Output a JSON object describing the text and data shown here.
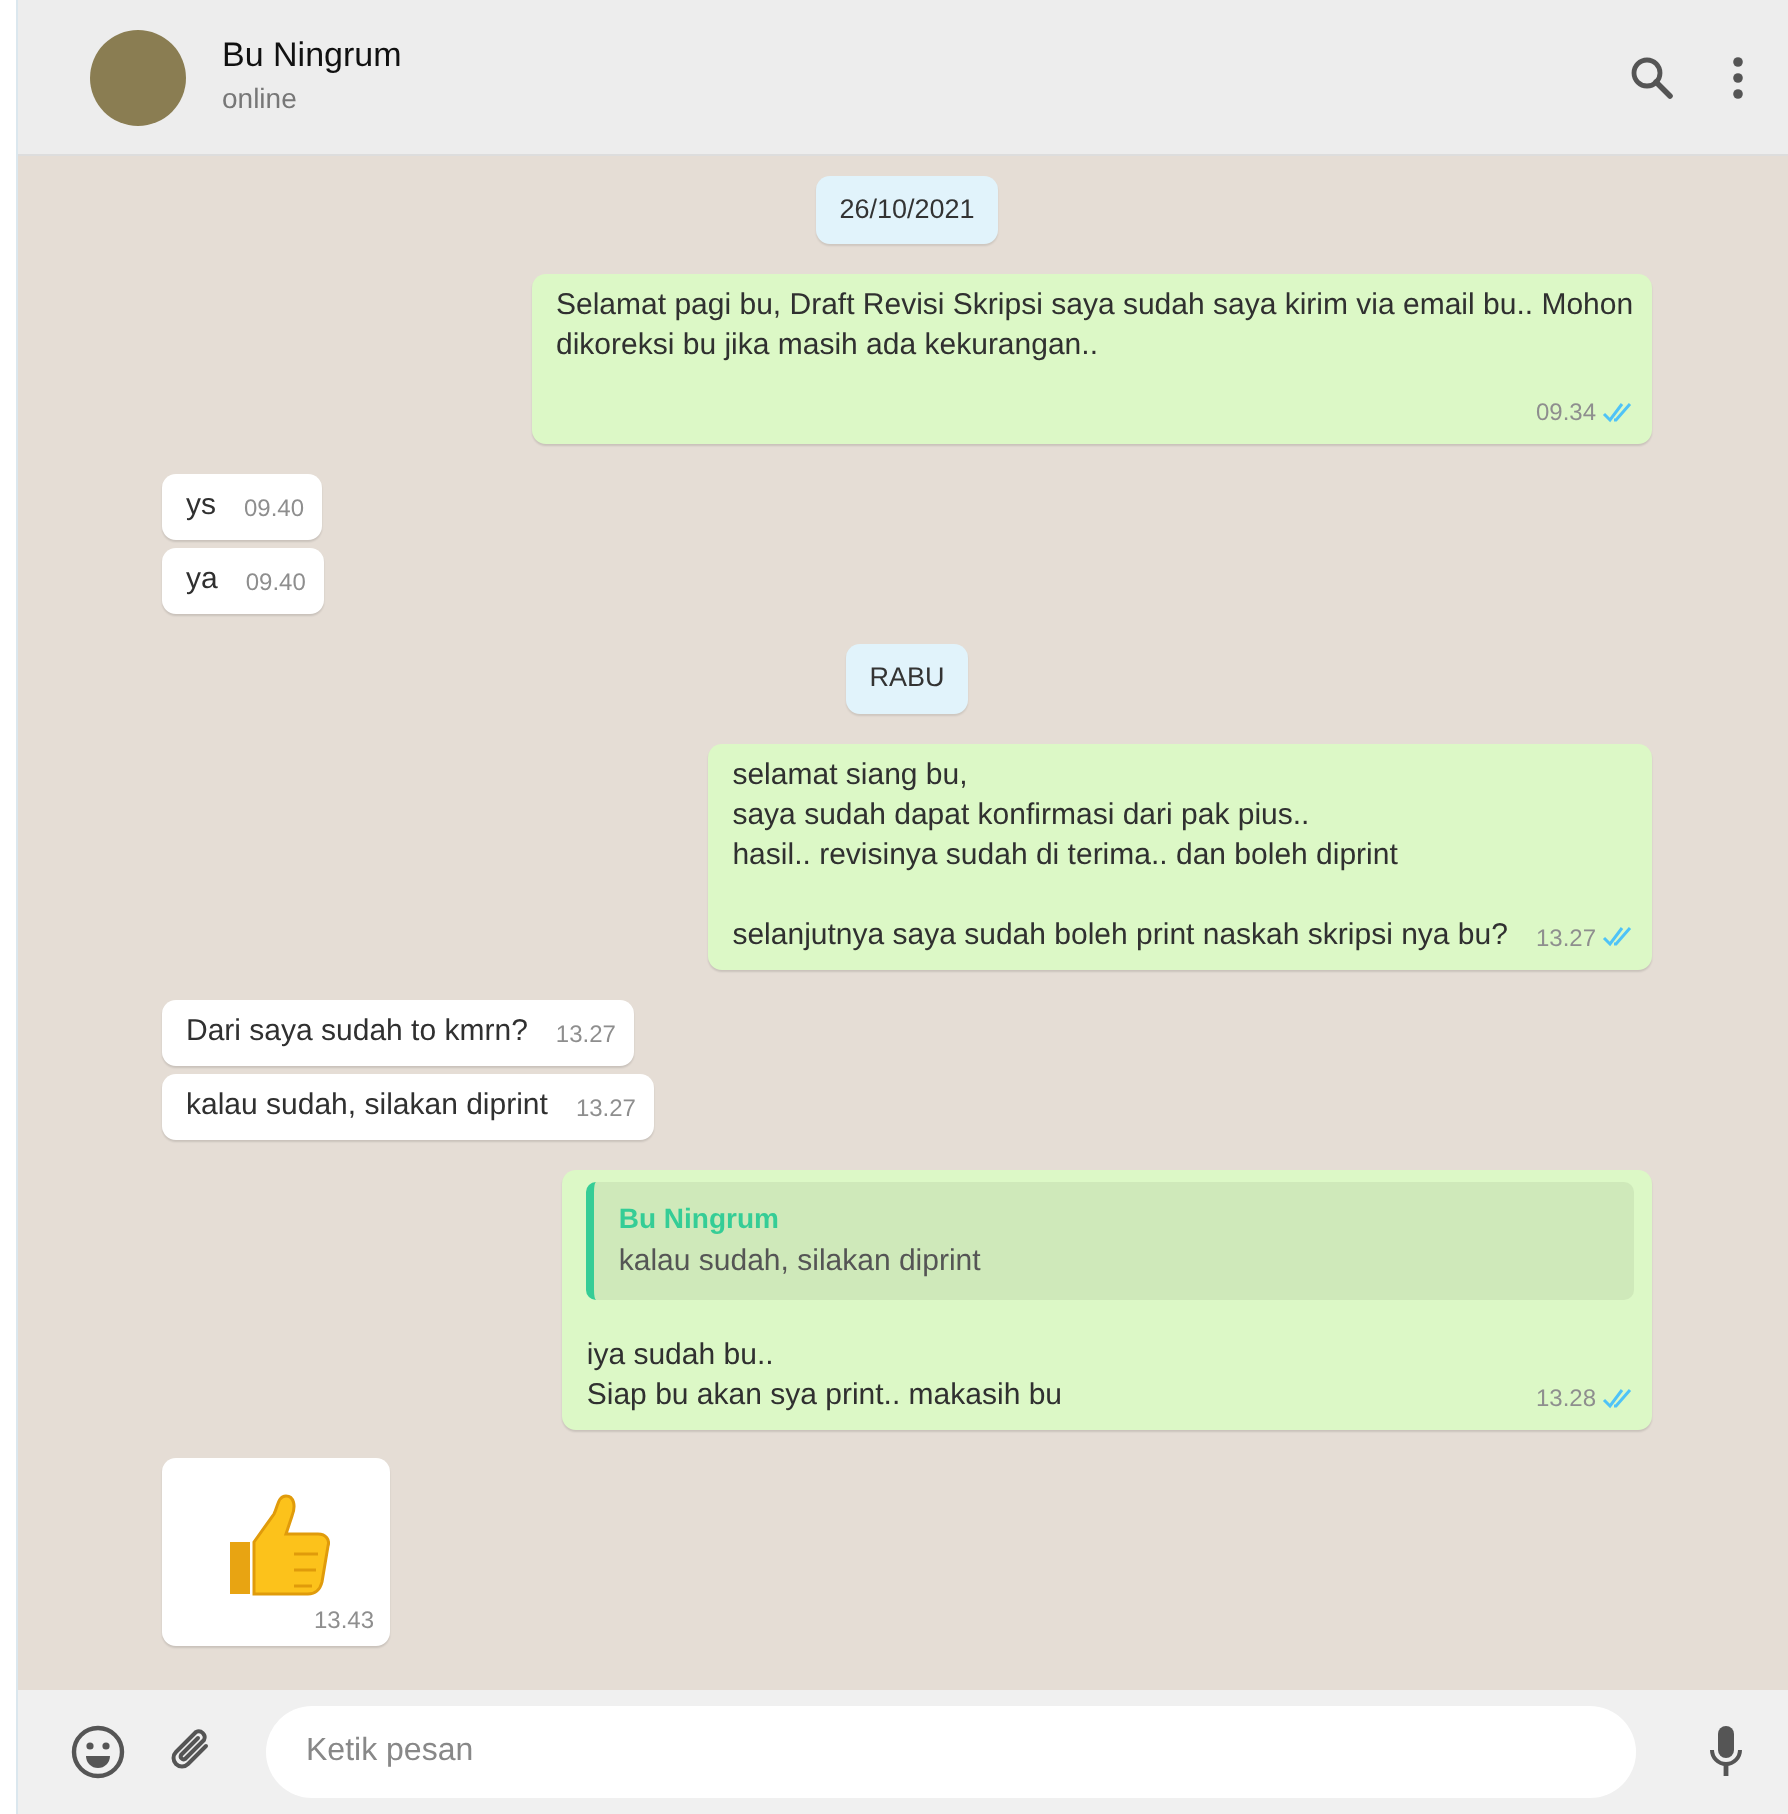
{
  "header": {
    "contact_name": "Bu Ningrum",
    "status": "online"
  },
  "messages": [
    {
      "kind": "date",
      "text": "26/10/2021"
    },
    {
      "kind": "out",
      "text": "Selamat pagi bu, Draft Revisi Skripsi saya sudah saya kirim via email bu.. Mohon dikoreksi bu jika masih ada kekurangan..",
      "time": "09.34",
      "read": true
    },
    {
      "kind": "in",
      "text": "ys",
      "time": "09.40"
    },
    {
      "kind": "in",
      "text": "ya",
      "time": "09.40"
    },
    {
      "kind": "date",
      "text": "RABU"
    },
    {
      "kind": "out",
      "text": "selamat siang bu,\nsaya sudah dapat konfirmasi dari pak pius..\nhasil.. revisinya sudah di terima.. dan boleh diprint\n\nselanjutnya saya sudah boleh print naskah skripsi nya bu?",
      "time": "13.27",
      "read": true
    },
    {
      "kind": "in",
      "text": "Dari saya sudah to kmrn?",
      "time": "13.27"
    },
    {
      "kind": "in",
      "text": "kalau sudah, silakan diprint",
      "time": "13.27"
    },
    {
      "kind": "out",
      "quote": {
        "sender": "Bu Ningrum",
        "text": "kalau sudah, silakan diprint"
      },
      "text": "iya sudah bu..\nSiap bu akan sya print.. makasih bu",
      "time": "13.28",
      "read": true
    },
    {
      "kind": "sticker",
      "time": "13.43"
    }
  ],
  "composer": {
    "placeholder": "Ketik pesan"
  }
}
